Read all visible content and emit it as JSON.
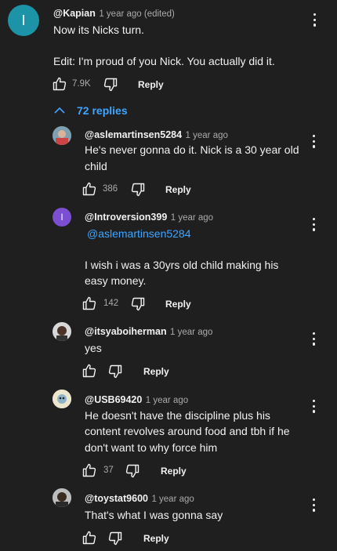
{
  "top_comment": {
    "avatar_letter": "I",
    "handle": "@Kapian",
    "time": "1 year ago (edited)",
    "text_line1": "Now its Nicks turn.",
    "text_line2": "Edit: I'm proud of you Nick. You actually did it.",
    "likes": "7.9K",
    "reply_label": "Reply"
  },
  "replies_toggle": {
    "label": "72 replies"
  },
  "replies": [
    {
      "handle": "@aslemartinsen5284",
      "time": "1 year ago",
      "text_line1": "He's never gonna do it. Nick is a 30 year old",
      "text_line2": "child",
      "likes": "386",
      "reply_label": "Reply"
    },
    {
      "avatar_letter": "I",
      "handle": "@Introversion399",
      "time": "1 year ago",
      "mention": "@aslemartinsen5284",
      "text_line1": "I wish i was a 30yrs old child making his",
      "text_line2": "easy money.",
      "likes": "142",
      "reply_label": "Reply"
    },
    {
      "handle": "@itsyaboiherman",
      "time": "1 year ago",
      "text_line1": "yes",
      "reply_label": "Reply"
    },
    {
      "handle": "@USB69420",
      "time": "1 year ago",
      "text_line1": "He doesn't have the discipline plus his",
      "text_line2": "content revolves around food and tbh if he",
      "text_line3": "don't want to why force him",
      "likes": "37",
      "reply_label": "Reply"
    },
    {
      "handle": "@toystat9600",
      "time": "1 year ago",
      "text_line1": "That's what I was gonna say",
      "reply_label": "Reply"
    }
  ],
  "colors": {
    "background": "#1f1f1f",
    "link": "#3ea6ff",
    "avatar_teal": "#1c93a7",
    "avatar_purple": "#7b4fd1"
  },
  "icons": [
    "thumbs-up-icon",
    "thumbs-down-icon",
    "more-vert-icon",
    "chevron-up-icon"
  ]
}
